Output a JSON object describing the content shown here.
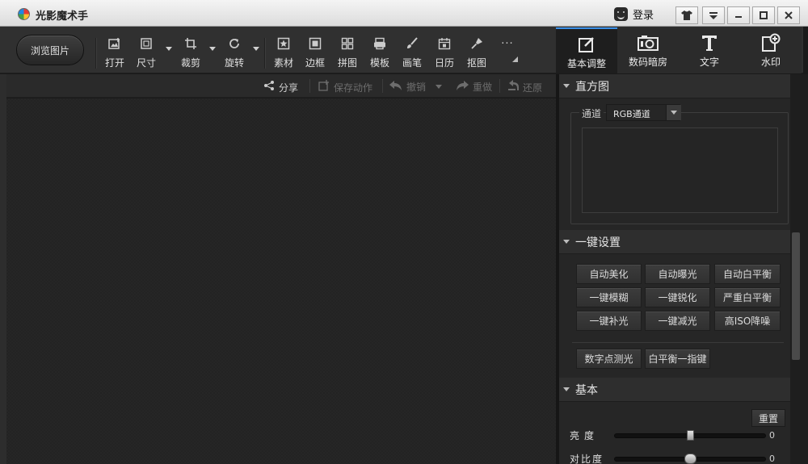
{
  "window": {
    "title": "光影魔术手",
    "login_label": "登录",
    "controls": [
      "shirt-icon",
      "menu-dropdown-icon",
      "minimize-icon",
      "maximize-icon",
      "close-icon"
    ]
  },
  "toolbar": {
    "browse_label": "浏览图片",
    "tools": [
      {
        "label": "打开",
        "icon": "open-image-icon"
      },
      {
        "label": "尺寸",
        "icon": "resize-icon"
      },
      {
        "label": "裁剪",
        "icon": "crop-icon"
      },
      {
        "label": "旋转",
        "icon": "rotate-icon"
      },
      {
        "label": "素材",
        "icon": "material-icon"
      },
      {
        "label": "边框",
        "icon": "frame-icon"
      },
      {
        "label": "拼图",
        "icon": "collage-icon"
      },
      {
        "label": "模板",
        "icon": "template-icon"
      },
      {
        "label": "画笔",
        "icon": "brush-icon"
      },
      {
        "label": "日历",
        "icon": "calendar-icon"
      },
      {
        "label": "抠图",
        "icon": "cutout-icon"
      }
    ],
    "more_label": "···"
  },
  "modes": [
    {
      "label": "基本调整",
      "icon": "basic-adjust-icon",
      "active": true
    },
    {
      "label": "数码暗房",
      "icon": "darkroom-icon",
      "active": false
    },
    {
      "label": "文字",
      "icon": "text-icon",
      "active": false
    },
    {
      "label": "水印",
      "icon": "watermark-icon",
      "active": false
    }
  ],
  "actions": {
    "share": "分享",
    "save_action": "保存动作",
    "undo": "撤销",
    "redo": "重做",
    "restore": "还原"
  },
  "histogram": {
    "title": "直方图",
    "channel_label": "通道",
    "channel_value": "RGB通道"
  },
  "oneclick": {
    "title": "一键设置",
    "buttons": [
      "自动美化",
      "自动曝光",
      "自动白平衡",
      "一键模糊",
      "一键锐化",
      "严重白平衡",
      "一键补光",
      "一键减光",
      "高ISO降噪"
    ],
    "extra": [
      "数字点测光",
      "白平衡一指键"
    ]
  },
  "basic": {
    "title": "基本",
    "reset_label": "重置",
    "sliders": [
      {
        "label": "亮度",
        "value": "0",
        "level": 0.5
      },
      {
        "label": "对比度",
        "value": "0",
        "level": 0.5
      }
    ]
  },
  "colors": {
    "accent": "#3a8ee6",
    "panel_bg": "#262626",
    "toolbar_bg": "#303030"
  }
}
